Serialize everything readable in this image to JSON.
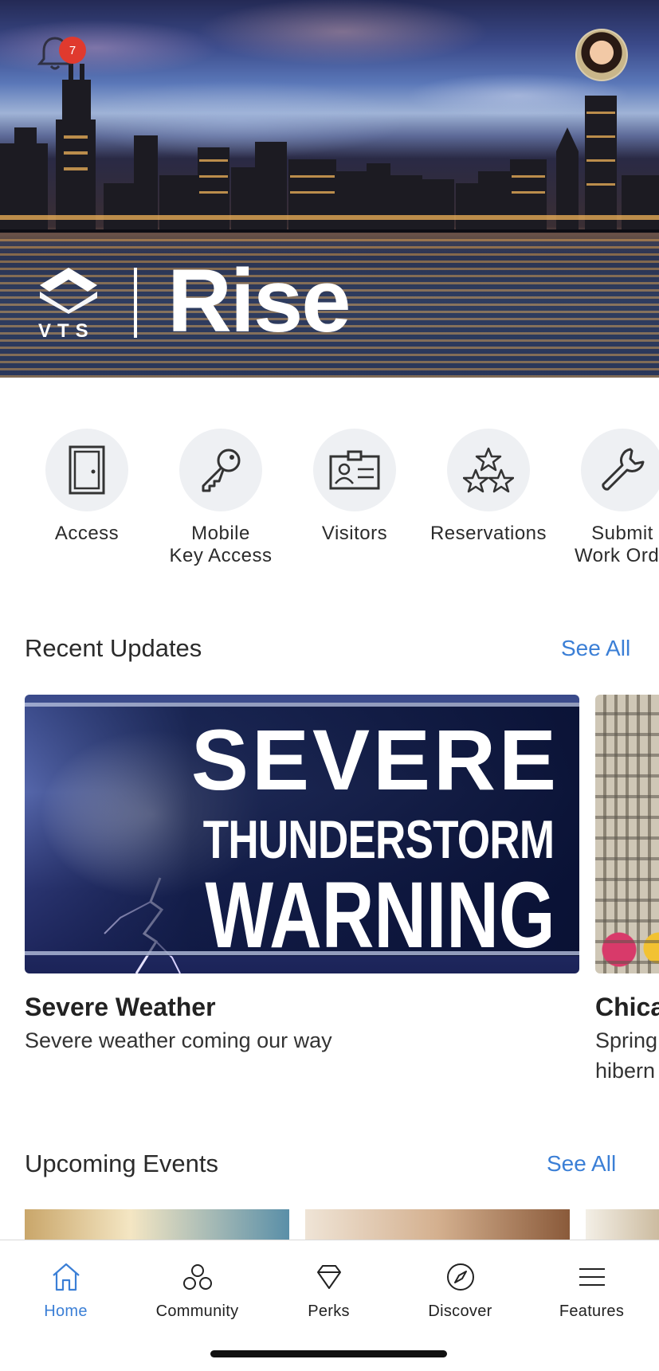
{
  "hero": {
    "notification_count": "7",
    "brand_small": "VTS",
    "brand_name": "Rise"
  },
  "quick_actions": [
    {
      "label": "Access",
      "icon": "door-icon"
    },
    {
      "label": "Mobile\nKey Access",
      "icon": "key-icon"
    },
    {
      "label": "Visitors",
      "icon": "id-card-icon"
    },
    {
      "label": "Reservations",
      "icon": "stars-icon"
    },
    {
      "label": "Submit\nWork Orde",
      "icon": "wrench-icon"
    }
  ],
  "recent_updates": {
    "title": "Recent Updates",
    "see_all": "See All",
    "cards": [
      {
        "image_text": [
          "SEVERE",
          "THUNDERSTORM",
          "WARNING"
        ],
        "title": "Severe Weather",
        "text": "Severe weather coming our way"
      },
      {
        "title": "Chica",
        "text_line1": "Spring",
        "text_line2": "hibern"
      }
    ]
  },
  "upcoming_events": {
    "title": "Upcoming Events",
    "see_all": "See All"
  },
  "tabbar": [
    {
      "label": "Home",
      "icon": "home-icon",
      "active": true
    },
    {
      "label": "Community",
      "icon": "community-icon"
    },
    {
      "label": "Perks",
      "icon": "diamond-icon"
    },
    {
      "label": "Discover",
      "icon": "compass-icon"
    },
    {
      "label": "Features",
      "icon": "menu-icon"
    }
  ],
  "colors": {
    "accent": "#3b7fd6",
    "badge": "#e03a2e",
    "icon_bg": "#eef0f3"
  }
}
